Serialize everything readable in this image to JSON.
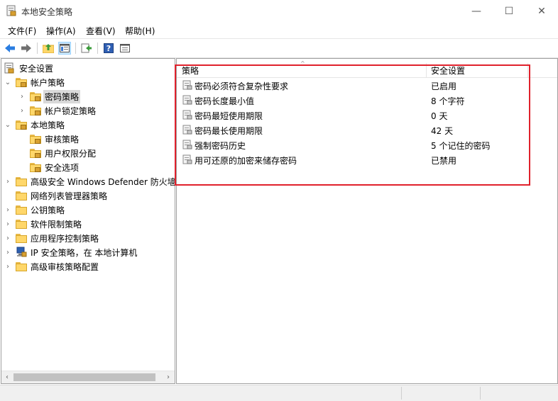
{
  "window": {
    "title": "本地安全策略",
    "minimize": "—",
    "maximize": "☐",
    "close": "✕"
  },
  "menu": [
    "文件(F)",
    "操作(A)",
    "查看(V)",
    "帮助(H)"
  ],
  "toolbar": [
    "back-icon",
    "forward-icon",
    "up-folder-icon",
    "show-tree-icon",
    "export-icon",
    "help-icon",
    "properties-icon"
  ],
  "tree": {
    "root": "安全设置",
    "items": [
      {
        "label": "帐户策略",
        "arrow": "⌄"
      },
      {
        "label": "密码策略",
        "arrow": "›"
      },
      {
        "label": "帐户锁定策略",
        "arrow": "›"
      },
      {
        "label": "本地策略",
        "arrow": "⌄"
      },
      {
        "label": "审核策略",
        "arrow": ""
      },
      {
        "label": "用户权限分配",
        "arrow": ""
      },
      {
        "label": "安全选项",
        "arrow": ""
      },
      {
        "label": "高级安全 Windows Defender 防火墙",
        "arrow": "›"
      },
      {
        "label": "网络列表管理器策略",
        "arrow": ""
      },
      {
        "label": "公钥策略",
        "arrow": "›"
      },
      {
        "label": "软件限制策略",
        "arrow": "›"
      },
      {
        "label": "应用程序控制策略",
        "arrow": "›"
      },
      {
        "label": "IP 安全策略，在 本地计算机",
        "arrow": "›"
      },
      {
        "label": "高级审核策略配置",
        "arrow": "›"
      }
    ],
    "scroll_left": "‹",
    "scroll_right": "›"
  },
  "list": {
    "columns": [
      "策略",
      "安全设置"
    ],
    "rows": [
      {
        "name": "密码必须符合复杂性要求",
        "value": "已启用"
      },
      {
        "name": "密码长度最小值",
        "value": "8 个字符"
      },
      {
        "name": "密码最短使用期限",
        "value": "0 天"
      },
      {
        "name": "密码最长使用期限",
        "value": "42 天"
      },
      {
        "name": "强制密码历史",
        "value": "5 个记住的密码"
      },
      {
        "name": "用可还原的加密来储存密码",
        "value": "已禁用"
      }
    ]
  },
  "colors": {
    "highlight": "#e0212c",
    "selected": "#d9d9d9"
  }
}
